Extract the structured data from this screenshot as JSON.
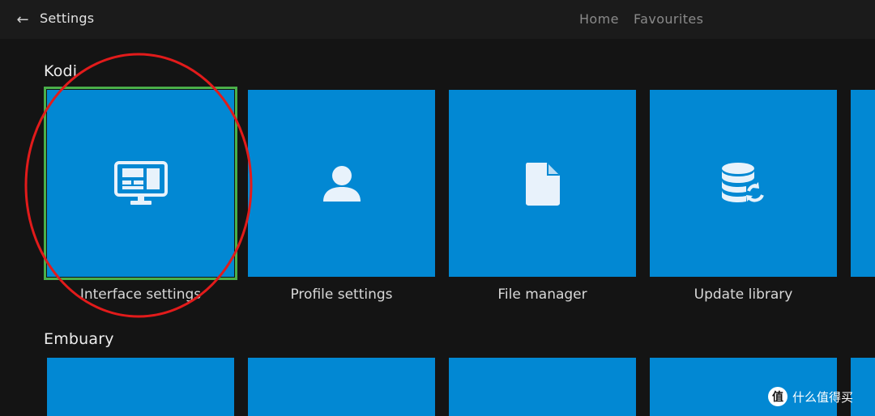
{
  "header": {
    "back_icon": "arrow-left-icon",
    "title": "Settings",
    "nav": [
      {
        "label": "Home"
      },
      {
        "label": "Favourites"
      }
    ]
  },
  "sections": [
    {
      "title": "Kodi",
      "tiles": [
        {
          "label": "Interface settings",
          "icon": "monitor-icon"
        },
        {
          "label": "Profile settings",
          "icon": "user-icon"
        },
        {
          "label": "File manager",
          "icon": "file-icon"
        },
        {
          "label": "Update library",
          "icon": "database-sync-icon"
        }
      ]
    },
    {
      "title": "Embuary"
    }
  ],
  "watermark": {
    "icon_text": "值",
    "text": "什么值得买"
  },
  "colors": {
    "tile": "#0288d3",
    "focus": "#4ab04a",
    "annotation": "#e21b1b",
    "background": "#141414"
  }
}
